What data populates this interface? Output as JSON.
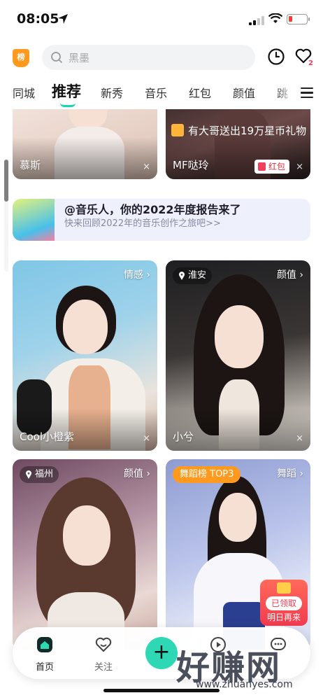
{
  "status_bar": {
    "time": "08:05"
  },
  "header": {
    "rank_badge": "榜",
    "search_placeholder": "黑墨",
    "notification_count": "2"
  },
  "tabs": [
    "同城",
    "推荐",
    "新秀",
    "音乐",
    "红包",
    "颜值",
    "跳"
  ],
  "active_tab": "推荐",
  "feed": {
    "top_left": {
      "name": "慕斯"
    },
    "top_right": {
      "name": "MF哒玲",
      "gift_banner": "有大哥送出19万星币礼物",
      "redpack": "红包"
    },
    "report": {
      "title": "@音乐人，你的2022年度报告来了",
      "subtitle": "快来回顾2022年的音乐创作之旅吧>>"
    },
    "cards": [
      {
        "name": "Cool小橙紫",
        "category": "情感 ›"
      },
      {
        "name": "小兮",
        "category": "颜值 ›",
        "location": "淮安"
      },
      {
        "name": "",
        "category": "颜值 ›",
        "location": "福州"
      },
      {
        "name": "",
        "category": "舞蹈 ›",
        "rank": "舞蹈榜 TOP3"
      }
    ],
    "close_icon": "×",
    "claim": {
      "badge": "已领取",
      "text": "明日再来"
    }
  },
  "bottom_nav": {
    "home": "首页",
    "follow": "关注",
    "add": "+"
  },
  "watermark": {
    "brand": "好赚网",
    "url": "www.zhuanyes.com"
  },
  "colors": {
    "accent": "#2fd8b4",
    "rank_orange": "#ff9a1f",
    "red": "#f23b4f"
  }
}
